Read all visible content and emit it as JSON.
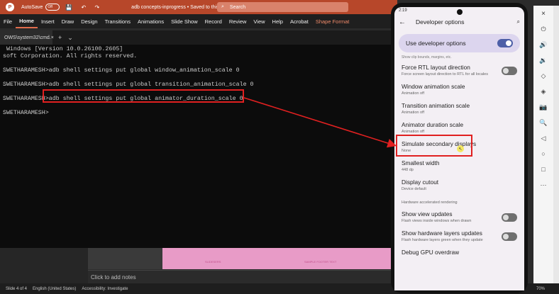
{
  "ppt": {
    "logo": "P",
    "autosave": "AutoSave",
    "toggle": "Off",
    "quick_access": "💾 ↶ ↷",
    "doc_title": "adb concepts-inprogress • Saved to this PC ⌄",
    "search_placeholder": "Search",
    "tabs": [
      "File",
      "Home",
      "Insert",
      "Draw",
      "Design",
      "Transitions",
      "Animations",
      "Slide Show",
      "Record",
      "Review",
      "View",
      "Help",
      "Acrobat",
      "Shape Format"
    ],
    "notes_placeholder": "Click to add notes",
    "slide_text_left": "SLIDESERS",
    "slide_text_right": "SAMPLE FOOTER TEXT"
  },
  "terminal": {
    "tab_title": "OWS\\system32\\cmd.",
    "tab_close": "×",
    "new_tab": "+",
    "dropdown": "⌄",
    "lines": [
      " Windows [Version 10.0.26100.2605]",
      "soft Corporation. All rights reserved.",
      "",
      "SWETHARAMESH>adb shell settings put global window_animation_scale 0",
      "",
      "SWETHARAMESH>adb shell settings put global transition_animation_scale 0",
      "",
      "SWETHARAMESH>adb shell settings put global animator_duration_scale 0",
      "",
      "SWETHARAMESH>"
    ]
  },
  "statusbar": {
    "slide": "Slide 4 of 4",
    "language": "English (United States)",
    "accessibility": "Accessibility: Investigate",
    "zoom": "70%"
  },
  "phone": {
    "time": "2:19",
    "title": "Developer options",
    "back_icon": "←",
    "search_icon": "🔍",
    "master_toggle_label": "Use developer options",
    "clipped_text": "Show clip bounds, margins, etc.",
    "prefs": [
      {
        "title": "Force RTL layout direction",
        "summary": "Force screen layout direction to RTL for all locales",
        "toggle": "off"
      },
      {
        "title": "Window animation scale",
        "summary": "Animation off",
        "toggle": ""
      },
      {
        "title": "Transition animation scale",
        "summary": "Animation off",
        "toggle": ""
      },
      {
        "title": "Animator duration scale",
        "summary": "Animation off",
        "toggle": ""
      },
      {
        "title": "Simulate secondary displays",
        "summary": "None",
        "toggle": ""
      },
      {
        "title": "Smallest width",
        "summary": "448 dp",
        "toggle": ""
      },
      {
        "title": "Display cutout",
        "summary": "Device default",
        "toggle": ""
      }
    ],
    "section": "Hardware accelerated rendering",
    "prefs2": [
      {
        "title": "Show view updates",
        "summary": "Flash views inside windows when drawn",
        "toggle": "off"
      },
      {
        "title": "Show hardware layers updates",
        "summary": "Flash hardware layers green when they update",
        "toggle": "off"
      }
    ],
    "bottom_cut": "Debug GPU overdraw"
  },
  "emulator": {
    "icons": [
      "×",
      "⏻",
      "🔊",
      "🔉",
      "◇",
      "◈",
      "📷",
      "🔍",
      "◁",
      "○",
      "□",
      "⋯"
    ]
  },
  "colors": {
    "ppt_accent": "#b7472a",
    "annotation_red": "#e02020",
    "toggle_on": "#4d5fa7"
  }
}
